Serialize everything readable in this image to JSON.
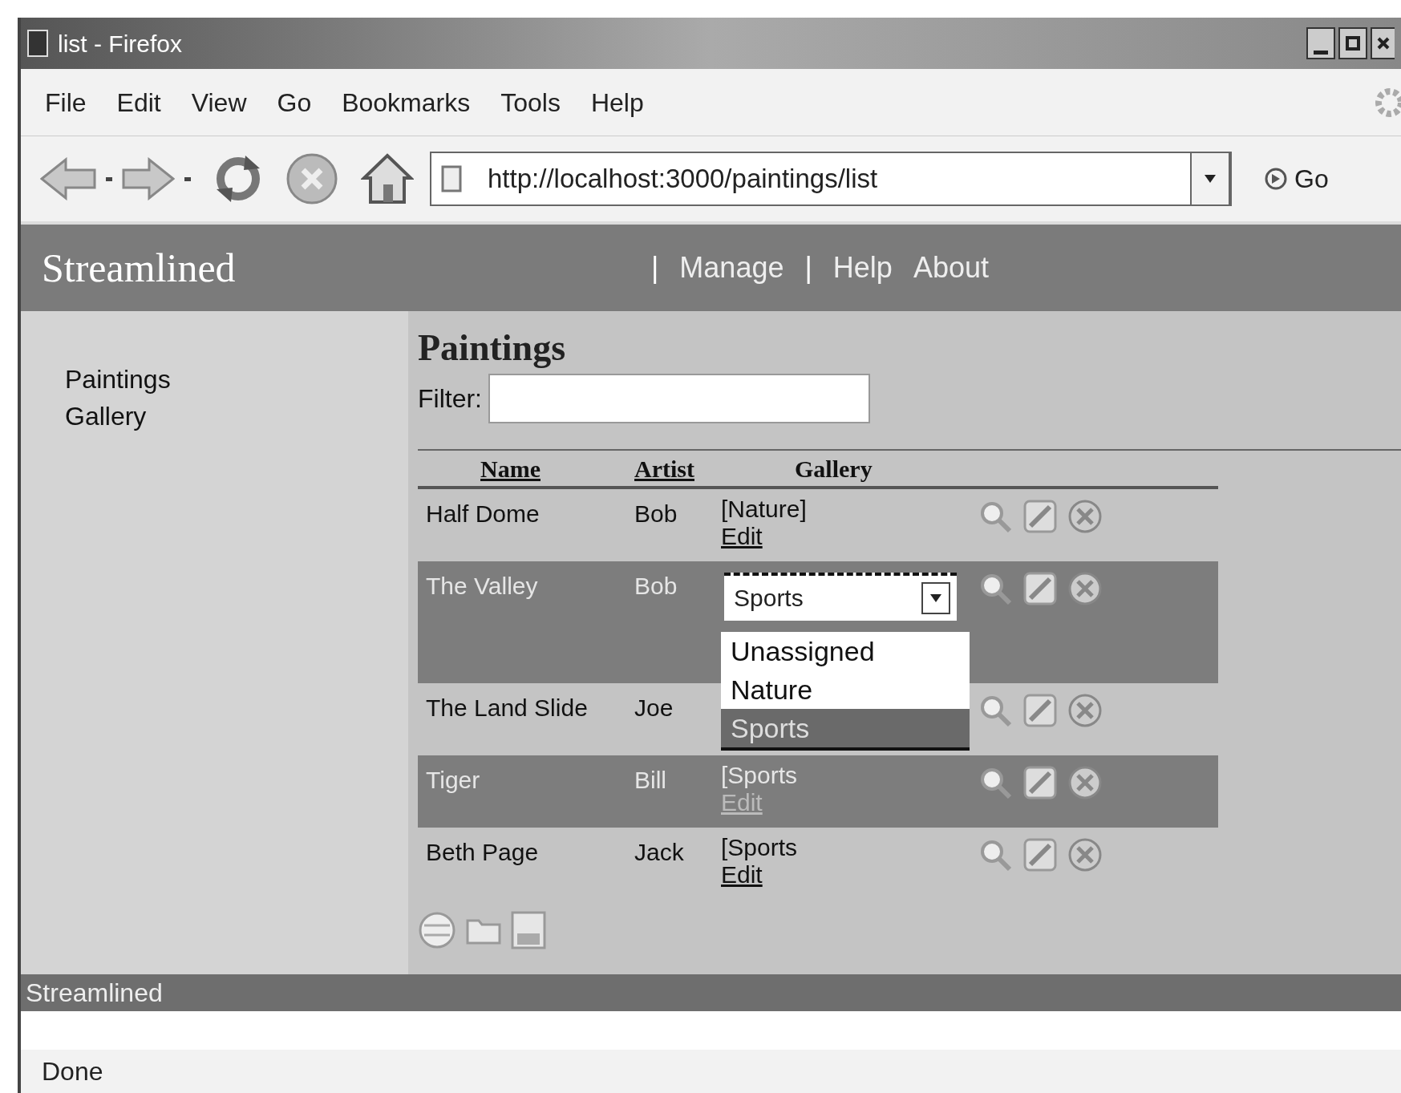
{
  "window": {
    "title": "list - Firefox"
  },
  "menu": [
    "File",
    "Edit",
    "View",
    "Go",
    "Bookmarks",
    "Tools",
    "Help"
  ],
  "address": {
    "value": "http://localhost:3000/paintings/list",
    "go": "Go"
  },
  "header": {
    "brand": "Streamlined",
    "nav": [
      {
        "kind": "separator",
        "text": "|"
      },
      {
        "kind": "link",
        "text": "Manage"
      },
      {
        "kind": "separator",
        "text": "|"
      },
      {
        "kind": "link",
        "text": "Help"
      },
      {
        "kind": "link",
        "text": "About"
      }
    ]
  },
  "sidebar": {
    "items": [
      "Paintings",
      "Gallery"
    ]
  },
  "page": {
    "title": "Paintings",
    "filter_label": "Filter:"
  },
  "table": {
    "columns": [
      {
        "label": "Name",
        "sortable": true
      },
      {
        "label": "Artist",
        "sortable": true
      },
      {
        "label": "Gallery",
        "sortable": false
      }
    ],
    "rows": [
      {
        "kind": "text",
        "shaded": false,
        "name": "Half Dome",
        "artist": "Bob",
        "gallery": "[Nature]",
        "edit": "Edit"
      },
      {
        "kind": "editing",
        "shaded": true,
        "name": "The Valley",
        "artist": "Bob",
        "select": {
          "value": "Sports",
          "options": [
            {
              "label": "Unassigned",
              "selected": false
            },
            {
              "label": "Nature",
              "selected": false
            },
            {
              "label": "Sports",
              "selected": true
            }
          ]
        }
      },
      {
        "kind": "covered",
        "shaded": false,
        "name": "The Land Slide",
        "artist": "Joe"
      },
      {
        "kind": "text",
        "shaded": true,
        "name": "Tiger",
        "artist": "Bill",
        "gallery": "[Sports",
        "edit": "Edit"
      },
      {
        "kind": "text",
        "shaded": false,
        "name": "Beth Page",
        "artist": "Jack",
        "gallery": "[Sports",
        "edit": "Edit"
      }
    ]
  },
  "footer": "Streamlined",
  "status_bar": "Done"
}
